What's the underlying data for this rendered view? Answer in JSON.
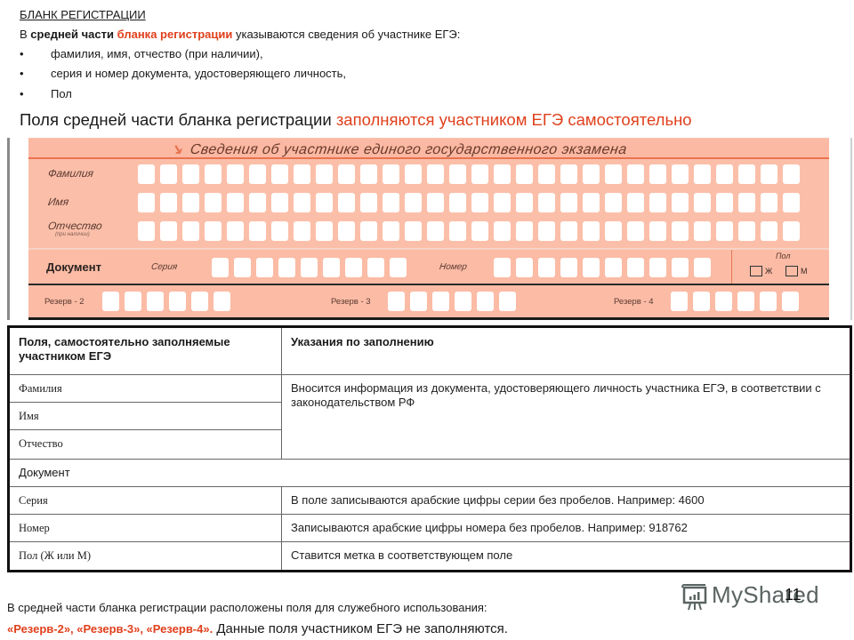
{
  "header": {
    "title": "БЛАНК РЕГИСТРАЦИИ",
    "intro": {
      "part1": "В ",
      "part2_bold": "средней части",
      "part3_space": " ",
      "part4_red_bold": "бланка регистрации",
      "part5": " указываются сведения об участнике ЕГЭ:"
    },
    "bullets": [
      "фамилия, имя, отчество (при наличии),",
      "серия и номер документа, удостоверяющего личность,",
      "Пол"
    ],
    "bullet_symbol": "•"
  },
  "heading": {
    "plain": "Поля средней части бланка регистрации ",
    "red": "заполняются участником ЕГЭ самостоятельно"
  },
  "form": {
    "title_arrow": "↘",
    "title": "Сведения об участнике единого государственного экзамена",
    "rows": [
      {
        "label": "Фамилия",
        "sublabel": "",
        "boxes": 30
      },
      {
        "label": "Имя",
        "sublabel": "",
        "boxes": 30
      },
      {
        "label": "Отчество",
        "sublabel": "(при наличии)",
        "boxes": 30
      }
    ],
    "document": {
      "label": "Документ",
      "series_label": "Серия",
      "series_boxes": 9,
      "number_label": "Номер",
      "number_boxes": 10,
      "gender_label": "Пол",
      "gender_options": [
        "Ж",
        "М"
      ]
    },
    "reserves": [
      {
        "label": "Резерв - 2",
        "boxes": 6
      },
      {
        "label": "Резерв - 3",
        "boxes": 6
      },
      {
        "label": "Резерв - 4",
        "boxes": 6
      }
    ]
  },
  "table": {
    "headers": [
      "Поля, самостоятельно заполняемые участником ЕГЭ",
      "Указания по заполнению"
    ],
    "name_fields": [
      "Фамилия",
      "Имя",
      "Отчество"
    ],
    "name_instruction": "Вносится информация из документа, удостоверяющего личность участника ЕГЭ, в соответствии с законодательством  РФ",
    "document_section": "Документ",
    "document_rows": [
      {
        "field": "Серия",
        "instruction": "В поле записываются арабские цифры серии без пробелов. Например: 4600"
      },
      {
        "field": "Номер",
        "instruction": "Записываются арабские цифры номера без пробелов. Например: 918762"
      },
      {
        "field": "Пол (Ж или М)",
        "instruction": "Ставится метка в соответствующем поле"
      }
    ]
  },
  "footer": {
    "line1": "В средней части бланка  регистрации расположены поля для служебного использования:",
    "line2_red": "«Резерв-2», «Резерв-3», «Резерв-4».",
    "line2_plain": " Данные поля участником ЕГЭ не заполняются."
  },
  "page_number": "11",
  "watermark": {
    "text": "MyShared",
    "icon": "presentation-board-icon"
  }
}
